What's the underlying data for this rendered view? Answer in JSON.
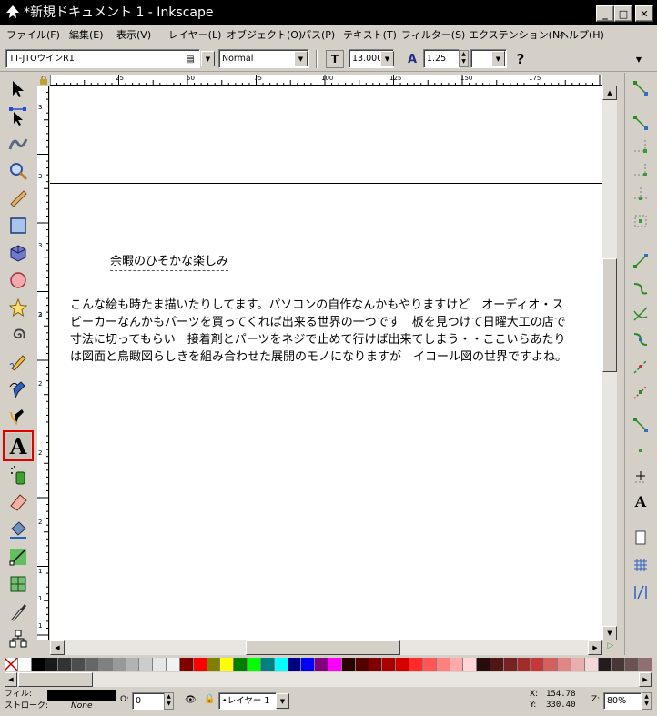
{
  "window": {
    "title": "*新規ドキュメント 1 - Inkscape",
    "minimize": "_",
    "maximize": "□",
    "close": "✕"
  },
  "menu": [
    "ファイル(F)",
    "編集(E)",
    "表示(V)",
    "レイヤー(L)",
    "オブジェクト(O)",
    "パス(P)",
    "テキスト(T)",
    "フィルター(S)",
    "エクステンション(N)",
    "ヘルプ(H)"
  ],
  "text_toolbar": {
    "font_family": "TT-JTOウインR1",
    "font_style": "Normal",
    "font_size": "13.000",
    "line_spacing": "1.25",
    "help_icon": "question-mark-icon"
  },
  "tools": [
    "selector-icon",
    "node-icon",
    "tweak-icon",
    "zoom-icon",
    "measure-icon",
    "rectangle-icon",
    "3d-box-icon",
    "ellipse-icon",
    "star-icon",
    "spiral-icon",
    "pencil-icon",
    "pen-icon",
    "calligraphy-icon",
    "text-icon",
    "spray-icon",
    "eraser-icon",
    "paint-bucket-icon",
    "gradient-icon",
    "mesh-icon",
    "dropper-icon",
    "connector-icon"
  ],
  "rulers": {
    "horizontal": [
      "25",
      "50",
      "75",
      "100",
      "125",
      "150",
      "175"
    ],
    "vertical": [
      "3",
      "3",
      "3",
      "3",
      "2",
      "2",
      "2",
      "2",
      "1",
      "1",
      "1"
    ]
  },
  "canvas": {
    "heading": "余暇のひそかな楽しみ",
    "paragraph": "こんな絵も時たま描いたりしてます。パソコンの自作なんかもやりますけど　オーディオ・ス\nピーカーなんかもパーツを買ってくれば出来る世界の一つです　板を見つけて日曜大工の店で\n寸法に切ってもらい　接着剤とパーツをネジで止めて行けば出来てしまう・・ここいらあたり\nは図面と鳥瞰図らしきを組み合わせた展開のモノになりますが　イコール図の世界ですよね。"
  },
  "palette_colors": [
    "#ffffff",
    "#000000",
    "#1a1a1a",
    "#333333",
    "#4d4d4d",
    "#666666",
    "#808080",
    "#999999",
    "#b3b3b3",
    "#cccccc",
    "#e6e6e6",
    "#f2f2f2",
    "#800000",
    "#ff0000",
    "#808000",
    "#ffff00",
    "#008000",
    "#00ff00",
    "#008080",
    "#00ffff",
    "#000080",
    "#0000ff",
    "#800080",
    "#ff00ff",
    "#2b0000",
    "#550000",
    "#800000",
    "#aa0000",
    "#d40000",
    "#ff2a2a",
    "#ff5555",
    "#ff8080",
    "#ffaaaa",
    "#ffd5d5",
    "#280b0b",
    "#501616",
    "#782121",
    "#a02c2c",
    "#c83737",
    "#d35f5f",
    "#de8787",
    "#e9afaf",
    "#f4d7d7",
    "#241c1c",
    "#483737",
    "#6c5353",
    "#916f6f"
  ],
  "status": {
    "fill_label": "フィル:",
    "stroke_label": "ストローク:",
    "stroke_value": "None",
    "opacity_label": "O:",
    "opacity_value": "0",
    "layer": "•レイヤー 1",
    "x_label": "X:",
    "x_value": "154.78",
    "y_label": "Y:",
    "y_value": "330.40",
    "zoom_label": "Z:",
    "zoom_value": "80%"
  }
}
